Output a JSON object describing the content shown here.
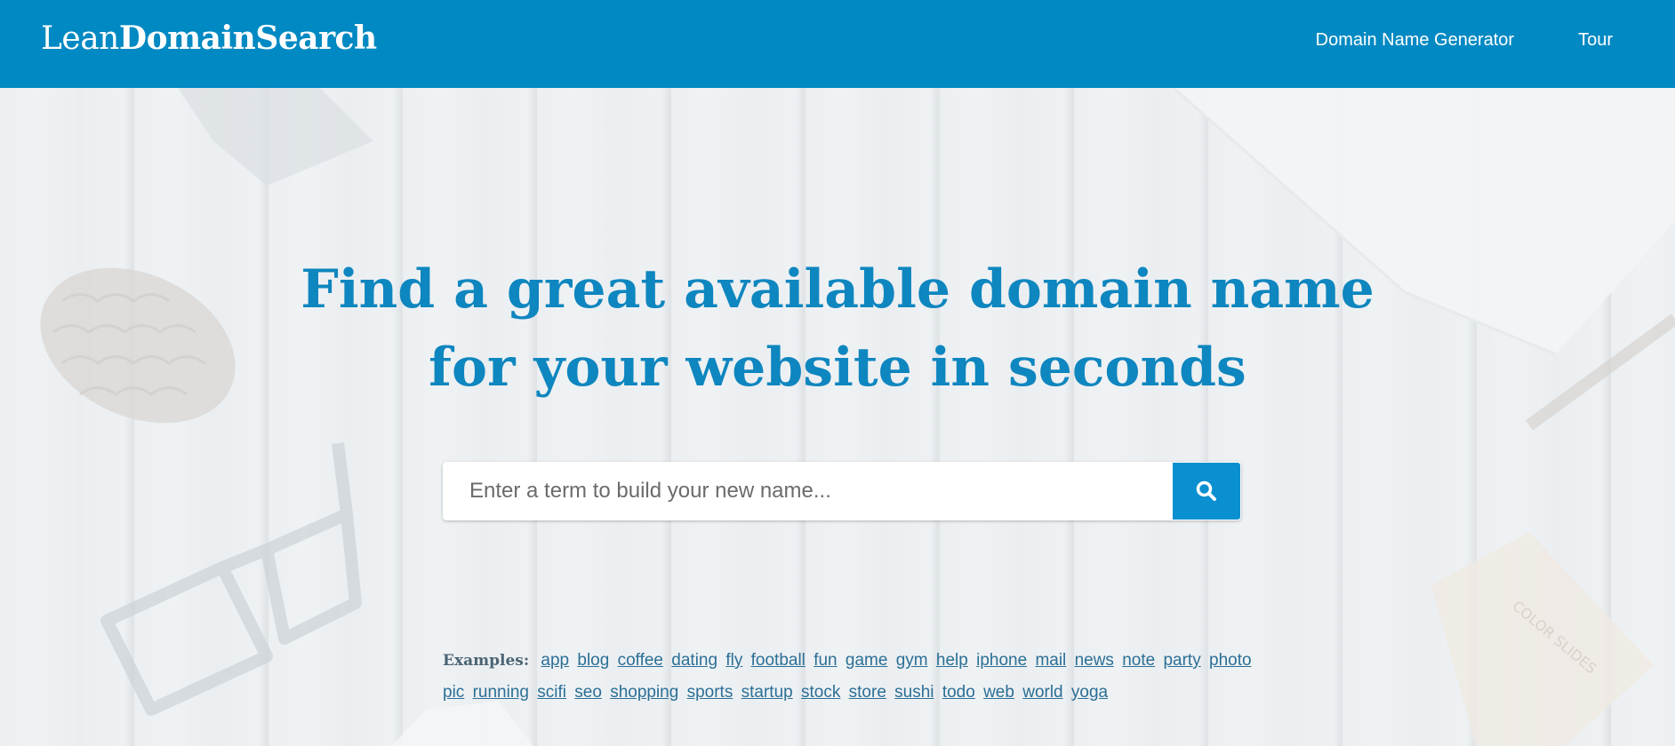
{
  "header": {
    "logo_light": "Lean",
    "logo_bold": "DomainSearch",
    "nav": [
      {
        "label": "Domain Name Generator"
      },
      {
        "label": "Tour"
      }
    ]
  },
  "hero": {
    "title_line1": "Find a great available domain name",
    "title_line2": "for your website in seconds"
  },
  "search": {
    "placeholder": "Enter a term to build your new name...",
    "value": "",
    "button_icon": "search-icon"
  },
  "examples": {
    "label": "Examples:",
    "items": [
      "app",
      "blog",
      "coffee",
      "dating",
      "fly",
      "football",
      "fun",
      "game",
      "gym",
      "help",
      "iphone",
      "mail",
      "news",
      "note",
      "party",
      "photo",
      "pic",
      "running",
      "scifi",
      "seo",
      "shopping",
      "sports",
      "startup",
      "stock",
      "store",
      "sushi",
      "todo",
      "web",
      "world",
      "yoga"
    ]
  },
  "colors": {
    "brand": "#0089c2",
    "title": "#0e86bf",
    "button": "#0a8fd0",
    "link": "#2b6f96"
  }
}
